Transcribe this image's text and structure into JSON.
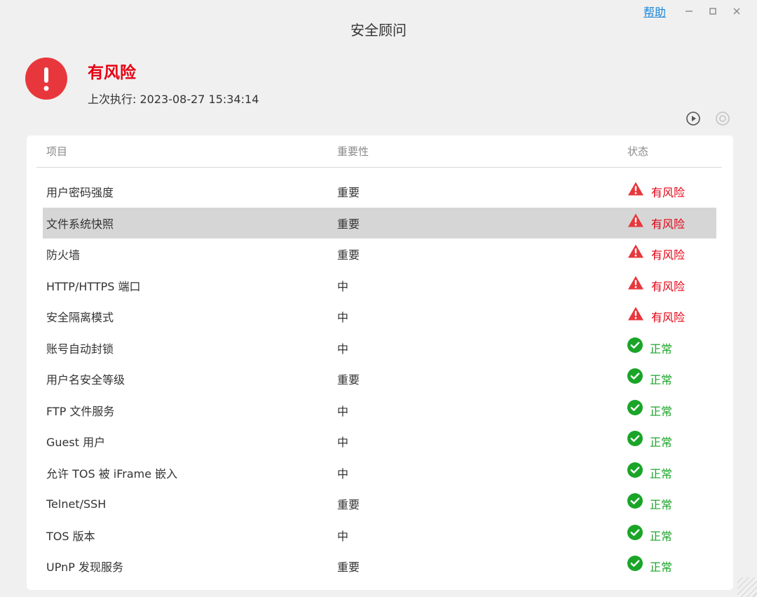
{
  "window": {
    "title": "安全顾问",
    "help_label": "帮助"
  },
  "summary": {
    "status_label": "有风险",
    "last_run": "上次执行: 2023-08-27 15:34:14"
  },
  "table": {
    "columns": [
      "项目",
      "重要性",
      "状态"
    ],
    "rows": [
      {
        "item": "用户密码强度",
        "importance": "重要",
        "status": "有风险",
        "status_type": "risk"
      },
      {
        "item": "文件系统快照",
        "importance": "重要",
        "status": "有风险",
        "status_type": "risk"
      },
      {
        "item": "防火墙",
        "importance": "重要",
        "status": "有风险",
        "status_type": "risk"
      },
      {
        "item": "HTTP/HTTPS 端口",
        "importance": "中",
        "status": "有风险",
        "status_type": "risk"
      },
      {
        "item": "安全隔离模式",
        "importance": "中",
        "status": "有风险",
        "status_type": "risk"
      },
      {
        "item": "账号自动封锁",
        "importance": "中",
        "status": "正常",
        "status_type": "ok"
      },
      {
        "item": "用户名安全等级",
        "importance": "重要",
        "status": "正常",
        "status_type": "ok"
      },
      {
        "item": "FTP 文件服务",
        "importance": "中",
        "status": "正常",
        "status_type": "ok"
      },
      {
        "item": "Guest 用户",
        "importance": "中",
        "status": "正常",
        "status_type": "ok"
      },
      {
        "item": "允许 TOS 被 iFrame 嵌入",
        "importance": "中",
        "status": "正常",
        "status_type": "ok"
      },
      {
        "item": "Telnet/SSH",
        "importance": "重要",
        "status": "正常",
        "status_type": "ok"
      },
      {
        "item": "TOS 版本",
        "importance": "中",
        "status": "正常",
        "status_type": "ok"
      },
      {
        "item": "UPnP 发现服务",
        "importance": "重要",
        "status": "正常",
        "status_type": "ok"
      }
    ]
  },
  "colors": {
    "risk": "#e60012",
    "risk_icon": "#e8373c",
    "ok": "#1aa528",
    "link": "#1a86d9",
    "selected_row": "#d6d6d6"
  },
  "icons": {
    "risk_summary": "exclamation-circle-icon",
    "run": "play-circle-icon",
    "stop": "stop-circle-icon",
    "risk_status": "warning-triangle-icon",
    "ok_status": "check-circle-icon"
  }
}
